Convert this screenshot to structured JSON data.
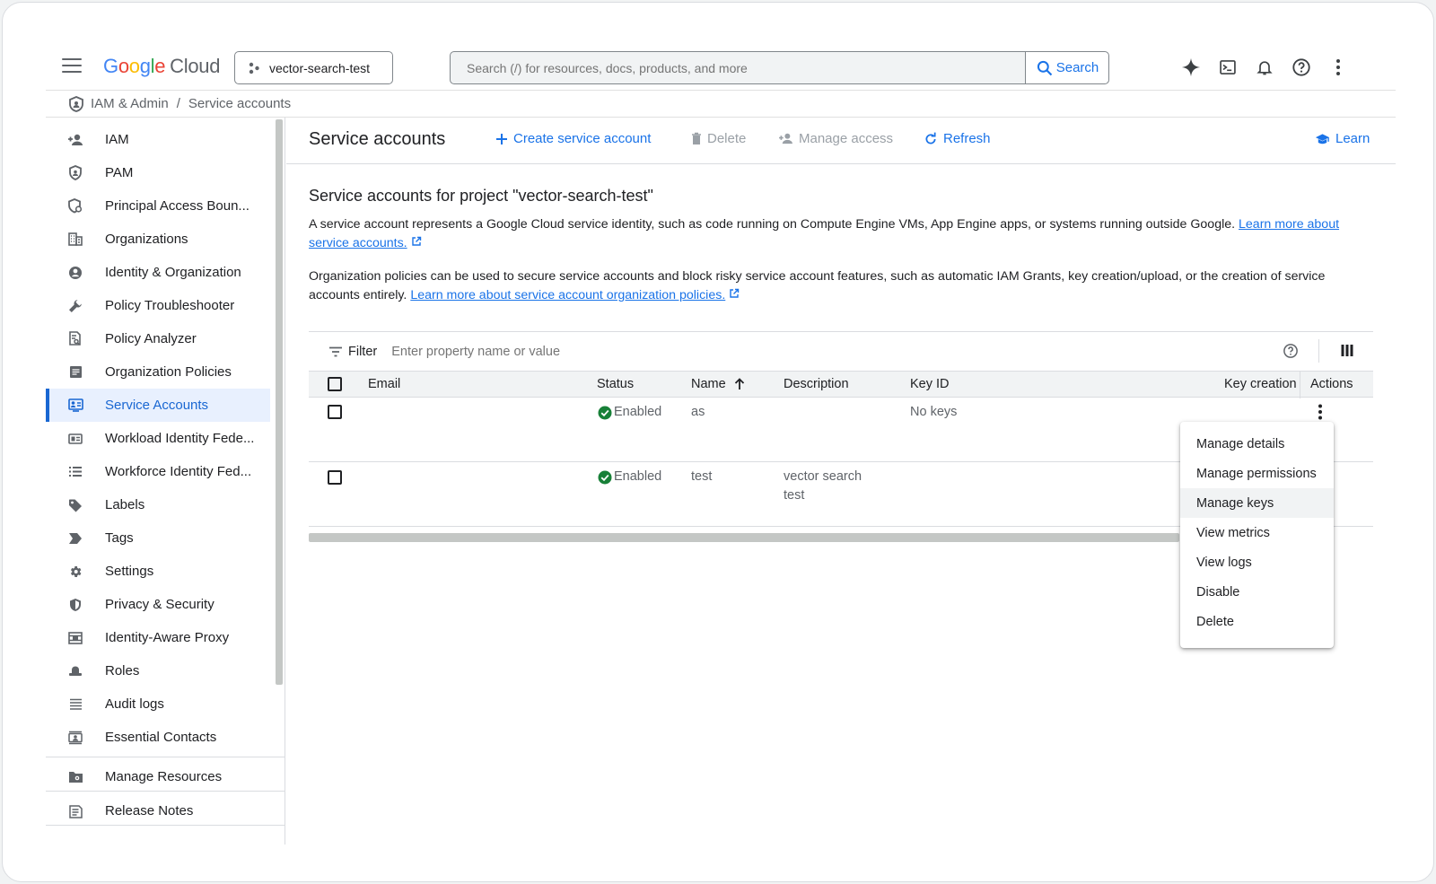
{
  "header": {
    "logo": {
      "g": "G",
      "o1": "o",
      "o2": "o",
      "g2": "g",
      "l": "l",
      "e": "e",
      "cloud": "Cloud"
    },
    "project": "vector-search-test",
    "search_placeholder": "Search (/) for resources, docs, products, and more",
    "search_button": "Search",
    "icons": [
      "gemini-icon",
      "cloud-shell-icon",
      "notifications-icon",
      "help-icon",
      "more-vert-icon"
    ]
  },
  "breadcrumb": {
    "parent": "IAM & Admin",
    "separator": "/",
    "current": "Service accounts"
  },
  "sidebar": {
    "items": [
      {
        "label": "IAM",
        "icon": "person-add-icon"
      },
      {
        "label": "PAM",
        "icon": "shield-icon"
      },
      {
        "label": "Principal Access Boun...",
        "icon": "policy-icon"
      },
      {
        "label": "Organizations",
        "icon": "organization-icon"
      },
      {
        "label": "Identity & Organization",
        "icon": "account-circle-icon"
      },
      {
        "label": "Policy Troubleshooter",
        "icon": "wrench-icon"
      },
      {
        "label": "Policy Analyzer",
        "icon": "document-search-icon"
      },
      {
        "label": "Organization Policies",
        "icon": "list-box-icon"
      },
      {
        "label": "Service Accounts",
        "icon": "service-account-icon",
        "active": true
      },
      {
        "label": "Workload Identity Fede...",
        "icon": "id-card-icon"
      },
      {
        "label": "Workforce Identity Fed...",
        "icon": "list-icon"
      },
      {
        "label": "Labels",
        "icon": "label-icon"
      },
      {
        "label": "Tags",
        "icon": "tag-icon"
      },
      {
        "label": "Settings",
        "icon": "gear-icon"
      },
      {
        "label": "Privacy & Security",
        "icon": "security-icon"
      },
      {
        "label": "Identity-Aware Proxy",
        "icon": "proxy-icon"
      },
      {
        "label": "Roles",
        "icon": "roles-hat-icon"
      },
      {
        "label": "Audit logs",
        "icon": "lines-icon"
      },
      {
        "label": "Essential Contacts",
        "icon": "contact-card-icon"
      }
    ],
    "bottom": [
      {
        "label": "Manage Resources",
        "icon": "folder-gear-icon"
      },
      {
        "label": "Release Notes",
        "icon": "release-notes-icon"
      }
    ]
  },
  "toolbar": {
    "title": "Service accounts",
    "create": "Create service account",
    "delete": "Delete",
    "manage_access": "Manage access",
    "refresh": "Refresh",
    "learn": "Learn"
  },
  "content": {
    "heading": "Service accounts for project \"vector-search-test\"",
    "para1": "A service account represents a Google Cloud service identity, such as code running on Compute Engine VMs, App Engine apps, or systems running outside Google.",
    "para1_link": "Learn more about service accounts.",
    "para2": "Organization policies can be used to secure service accounts and block risky service account features, such as automatic IAM Grants, key creation/upload, or the creation of service accounts entirely.",
    "para2_link": "Learn more about service account organization policies."
  },
  "table": {
    "filter_label": "Filter",
    "filter_placeholder": "Enter property name or value",
    "columns": {
      "email": "Email",
      "status": "Status",
      "name": "Name",
      "description": "Description",
      "key_id": "Key ID",
      "key_creation": "Key creation",
      "actions": "Actions"
    },
    "rows": [
      {
        "email": "",
        "status": "Enabled",
        "name": "as",
        "description": "",
        "key_id": "No keys"
      },
      {
        "email": "",
        "status": "Enabled",
        "name": "test",
        "description": "vector search test",
        "key_id": ""
      }
    ]
  },
  "actions_menu": {
    "items": [
      "Manage details",
      "Manage permissions",
      "Manage keys",
      "View metrics",
      "View logs",
      "Disable",
      "Delete"
    ],
    "highlighted": "Manage keys"
  },
  "colors": {
    "accent": "#1a73e8",
    "active_bg": "#e8f0fe",
    "enabled_green": "#188038",
    "disabled_text": "#9aa0a6"
  }
}
